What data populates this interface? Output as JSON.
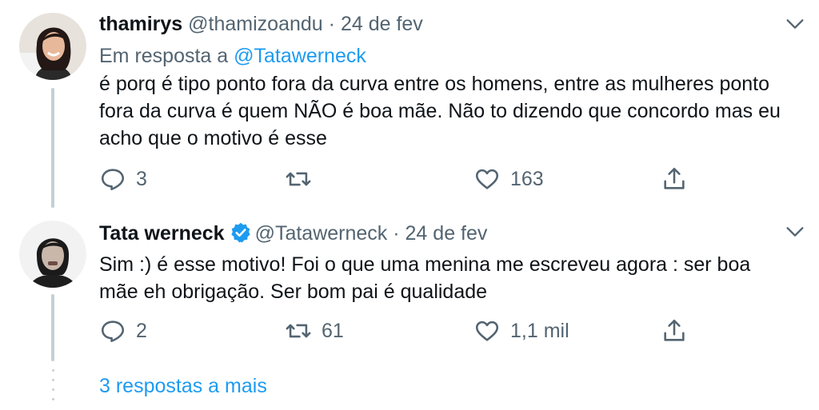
{
  "tweets": [
    {
      "name": "thamirys",
      "handle": "@thamizoandu",
      "separator": "·",
      "date": "24 de fev",
      "reply_prefix": "Em resposta a",
      "reply_to": "@Tatawerneck",
      "body_lines": [
        "é porq é tipo ponto fora da curva entre os homens, entre as mulheres ponto",
        "fora da curva é quem NÃO é boa mãe. Não to dizendo que concordo mas eu",
        "acho que o motivo é esse"
      ],
      "replies": "3",
      "retweets": "",
      "likes": "163",
      "verified": false
    },
    {
      "name": "Tata werneck",
      "handle": "@Tatawerneck",
      "separator": "·",
      "date": "24 de fev",
      "body_lines": [
        "Sim :) é esse motivo! Foi o que uma menina me escreveu agora : ser boa",
        "mãe eh obrigação. Ser bom pai é qualidade"
      ],
      "replies": "2",
      "retweets": "61",
      "likes": "1,1 mil",
      "verified": true
    }
  ],
  "more_replies": "3 respostas a mais",
  "colors": {
    "accent": "#1d9bf0",
    "secondary_text": "#536471",
    "thread_line": "#c4cfd6"
  },
  "icons": [
    "reply-icon",
    "retweet-icon",
    "like-icon",
    "share-icon",
    "chevron-down-icon",
    "verified-badge-icon"
  ]
}
